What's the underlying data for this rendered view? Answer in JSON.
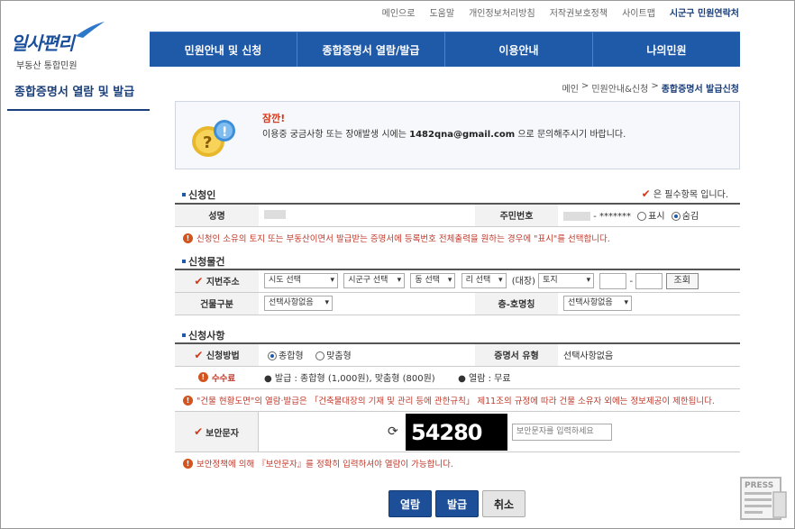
{
  "util_links": [
    "메인으로",
    "도움말",
    "개인정보처리방침",
    "저작권보호정책",
    "사이트맵",
    "시군구 민원연락처"
  ],
  "logo": {
    "title": "일사편리",
    "subtitle": "부동산 통합민원"
  },
  "gnb": [
    "민원안내 및 신청",
    "종합증명서 열람/발급",
    "이용안내",
    "나의민원"
  ],
  "lnb_title": "종합증명서 열람 및 발급",
  "breadcrumb": {
    "home": "메인",
    "sep": ">",
    "mid": "민원안내&신청",
    "current": "종합증명서 발급신청"
  },
  "notice": {
    "head": "잠깐!",
    "msg_pre": "이용중 궁금사항 또는 장애발생 시에는",
    "email": "1482qna@gmail.com",
    "msg_post": "으로 문의해주시기 바랍니다."
  },
  "applicant": {
    "title": "신청인",
    "required_note": "은 필수항목 입니다.",
    "name_label": "성명",
    "rrn_label": "주민번호",
    "rrn_mask": "- *******",
    "show_label": "표시",
    "hide_label": "숨김",
    "warn": "신청인 소유의 토지 또는 부동산이면서 발급받는 증명서에 등록번호 전체출력을 원하는 경우에 \"표시\"를 선택합니다."
  },
  "object": {
    "title": "신청물건",
    "address_label": "지번주소",
    "sido": "시도 선택",
    "sigungu": "시군구 선택",
    "dong": "동 선택",
    "ri": "리 선택",
    "daejang": "(대장)",
    "land": "토지",
    "dash": "-",
    "search_btn": "조회",
    "building_label": "건물구분",
    "building_value": "선택사항없음",
    "floor_label": "층-호명칭",
    "floor_value": "선택사항없음"
  },
  "request": {
    "title": "신청사항",
    "method_label": "신청방법",
    "method_general": "종합형",
    "method_custom": "맞춤형",
    "cert_type_label": "증명서 유형",
    "cert_type_value": "선택사항없음",
    "fee_label": "수수료",
    "fee_issue": "발급 : 종합형 (1,000원), 맞춤형 (800원)",
    "fee_view": "열람 : 무료",
    "warn": "\"건물 현황도면\"의 열람·발급은 「건축물대장의 기재 및 관리 등에 관한규칙」 제11조의 규정에 따라 건물 소유자 외에는 정보제공이 제한됩니다."
  },
  "captcha": {
    "label": "보안문자",
    "code": "54280",
    "placeholder": "보안문자를 입력하세요",
    "warn": "보안정책에 의해 『보안문자』를 정확히 입력하셔야 열람이 가능합니다."
  },
  "buttons": {
    "view": "열람",
    "issue": "발급",
    "cancel": "취소"
  },
  "press": "PRESS"
}
